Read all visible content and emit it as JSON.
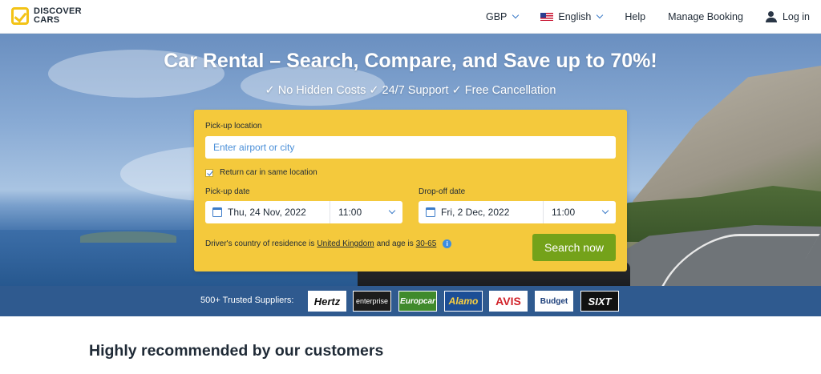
{
  "brand": {
    "line1": "DISCOVER",
    "line2": "CARS"
  },
  "nav": {
    "currency": "GBP",
    "language": "English",
    "help": "Help",
    "manage_booking": "Manage Booking",
    "login": "Log in"
  },
  "hero": {
    "title": "Car Rental – Search, Compare, and Save up to 70%!",
    "subtitle": "✓ No Hidden Costs ✓ 24/7 Support ✓ Free Cancellation"
  },
  "search": {
    "pickup_location_label": "Pick-up location",
    "pickup_location_placeholder": "Enter airport or city",
    "return_same_label": "Return car in same location",
    "return_same_checked": true,
    "pickup_date_label": "Pick-up date",
    "pickup_date": "Thu, 24 Nov, 2022",
    "pickup_time": "11:00",
    "dropoff_date_label": "Drop-off date",
    "dropoff_date": "Fri, 2 Dec, 2022",
    "dropoff_time": "11:00",
    "residence_prefix": "Driver's country of residence is",
    "residence_country": "United Kingdom",
    "residence_mid": "and age is",
    "residence_age": "30-65",
    "search_button": "Search now"
  },
  "suppliers": {
    "label": "500+ Trusted Suppliers:",
    "logos": [
      "Hertz",
      "enterprise",
      "Europcar",
      "Alamo",
      "AVIS",
      "Budget",
      "SIXT"
    ]
  },
  "section": {
    "title": "Highly recommended by our customers"
  },
  "colors": {
    "accent_yellow": "#f4c93c",
    "search_green": "#74a21a",
    "band_blue": "#2f5a8f",
    "link_blue": "#3d7cc9"
  }
}
